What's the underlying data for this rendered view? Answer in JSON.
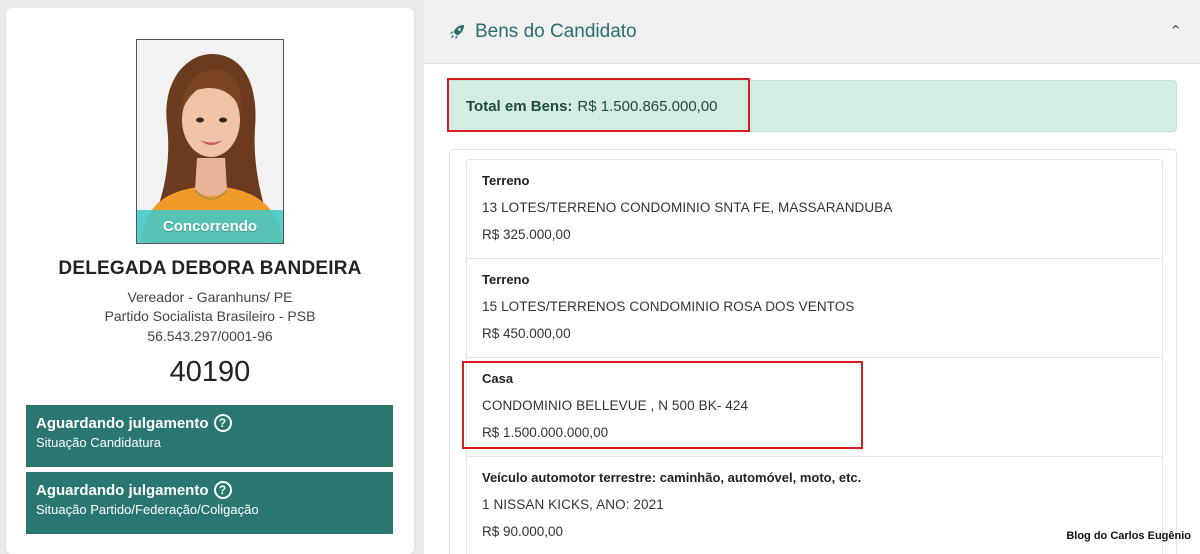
{
  "candidate": {
    "photo_status": "Concorrendo",
    "name": "DELEGADA DEBORA BANDEIRA",
    "office": "Vereador - Garanhuns/ PE",
    "party": "Partido Socialista Brasileiro - PSB",
    "cnpj": "56.543.297/0001-96",
    "number": "40190"
  },
  "situations": [
    {
      "title": "Aguardando julgamento",
      "subtitle": "Situação Candidatura"
    },
    {
      "title": "Aguardando julgamento",
      "subtitle": "Situação Partido/Federação/Coligação"
    }
  ],
  "assets_panel": {
    "title": "Bens do Candidato",
    "icon": "rocket-icon",
    "collapse_icon": "chevron-up-icon",
    "total_label": "Total em Bens:",
    "total_value": "R$ 1.500.865.000,00",
    "items": [
      {
        "type": "Terreno",
        "description": "13 LOTES/TERRENO CONDOMINIO SNTA FE, MASSARANDUBA",
        "value": "R$ 325.000,00"
      },
      {
        "type": "Terreno",
        "description": "15 LOTES/TERRENOS CONDOMINIO ROSA DOS VENTOS",
        "value": "R$ 450.000,00"
      },
      {
        "type": "Casa",
        "description": "CONDOMINIO BELLEVUE , N 500 BK- 424",
        "value": "R$ 1.500.000.000,00"
      },
      {
        "type": "Veículo automotor terrestre: caminhão, automóvel, moto, etc.",
        "description": "1 NISSAN KICKS, ANO: 2021",
        "value": "R$ 90.000,00"
      }
    ]
  },
  "watermark": "Blog do Carlos Eugênio",
  "colors": {
    "accent": "#2a7772",
    "title": "#2a6f6c",
    "status_strip": "#40c8c8",
    "total_bg": "#d4ede2",
    "highlight": "#d41f1f"
  }
}
